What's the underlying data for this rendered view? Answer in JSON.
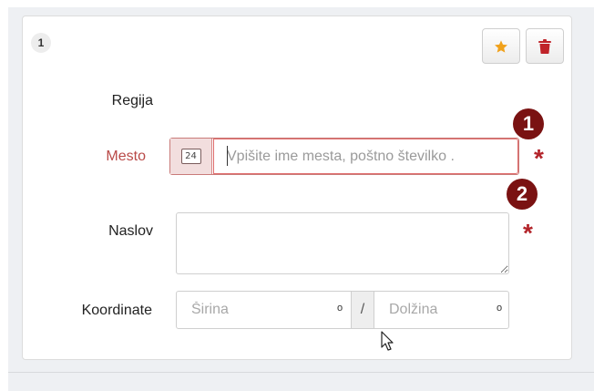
{
  "card": {
    "number": "1",
    "star_icon": "star-icon",
    "trash_icon": "trash-icon"
  },
  "form": {
    "region_label": "Regija",
    "city_label": "Mesto",
    "city_addon_text": "24",
    "city_placeholder": "Vpišite ime mesta, poštno številko .",
    "address_label": "Naslov",
    "coordinates_label": "Koordinate",
    "latitude_placeholder": "Širina",
    "longitude_placeholder": "Dolžina",
    "degree_symbol": "o",
    "separator": "/",
    "required_marker": "*"
  },
  "callouts": [
    "1",
    "2"
  ],
  "colors": {
    "accent_star": "#f0a11b",
    "danger": "#b3242a",
    "error_label": "#b94a48",
    "callout_bg": "#7a1212"
  }
}
